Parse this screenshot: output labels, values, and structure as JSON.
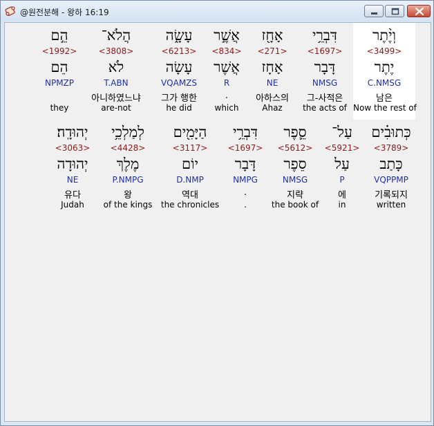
{
  "window": {
    "title": "@원전분해 - 왕하 16:19",
    "icon": "app-scroll-icon",
    "controls": [
      "minimize-icon",
      "maximize-icon",
      "close-icon"
    ],
    "accent": "#c94a33"
  },
  "colors": {
    "strong": "#8b1a1a",
    "parse": "#1f2fa8",
    "highlight": "#ffffff",
    "background": "#f0f0f0"
  },
  "lines": [
    {
      "words": [
        {
          "heb": "וְיֶ֨תֶר",
          "strong": "<3499>",
          "lemma": "יֶתֶר",
          "parse": "C.NMSG",
          "kor": "남은",
          "eng": "Now the rest of",
          "highlighted": true
        },
        {
          "heb": "דִּבְרֵ֥י",
          "strong": "<1697>",
          "lemma": "דָּבָר",
          "parse": "NMSG",
          "kor": "그-사적은",
          "eng": "the acts of",
          "highlighted": false
        },
        {
          "heb": "אָחָ֖ז",
          "strong": "<271>",
          "lemma": "אָחָז",
          "parse": "NE",
          "kor": "아하스의",
          "eng": "Ahaz",
          "highlighted": false
        },
        {
          "heb": "אֲשֶׁ֣ר",
          "strong": "<834>",
          "lemma": "אֲשֶׁר",
          "parse": "R",
          "kor": ".",
          "eng": "which",
          "highlighted": false
        },
        {
          "heb": "עָשָׂ֑ה",
          "strong": "<6213>",
          "lemma": "עָשָׂה",
          "parse": "VQAMZS",
          "kor": "그가 행한",
          "eng": "he did",
          "highlighted": false
        },
        {
          "heb": "הֲלֹא־",
          "strong": "<3808>",
          "lemma": "לֹא",
          "parse": "T.ABN",
          "kor": "아니하였느냐",
          "eng": "are-not",
          "highlighted": false
        },
        {
          "heb": "הֵ֣ם",
          "strong": "<1992>",
          "lemma": "הֵם",
          "parse": "NPMZP",
          "kor": "",
          "eng": "they",
          "highlighted": false
        }
      ]
    },
    {
      "words": [
        {
          "heb": "כְּתוּבִ֗ים",
          "strong": "<3789>",
          "lemma": "כָּתַב",
          "parse": "VQPPMP",
          "kor": "기록되지",
          "eng": "written",
          "highlighted": false
        },
        {
          "heb": "עַל־",
          "strong": "<5921>",
          "lemma": "עַל",
          "parse": "P",
          "kor": "에",
          "eng": "in",
          "highlighted": false
        },
        {
          "heb": "סֵ֛פֶר",
          "strong": "<5612>",
          "lemma": "סֵפֶר",
          "parse": "NMSG",
          "kor": "지략",
          "eng": "the book of",
          "highlighted": false
        },
        {
          "heb": "דִּבְרֵ֥י",
          "strong": "<1697>",
          "lemma": "דָּבָר",
          "parse": "NMPG",
          "kor": ".",
          "eng": ".",
          "highlighted": false
        },
        {
          "heb": "הַיָּמִ֖ים",
          "strong": "<3117>",
          "lemma": "יוֹם",
          "parse": "D.NMP",
          "kor": "역대",
          "eng": "the chronicles",
          "highlighted": false
        },
        {
          "heb": "לְמַלְכֵ֥י",
          "strong": "<4428>",
          "lemma": "מֶלֶךְ",
          "parse": "P.NMPG",
          "kor": "왕",
          "eng": "of the kings",
          "highlighted": false
        },
        {
          "heb": "יְהוּדָֽה׃",
          "strong": "<3063>",
          "lemma": "יְהוּדָה",
          "parse": "NE",
          "kor": "유다",
          "eng": "Judah",
          "highlighted": false
        }
      ]
    }
  ]
}
